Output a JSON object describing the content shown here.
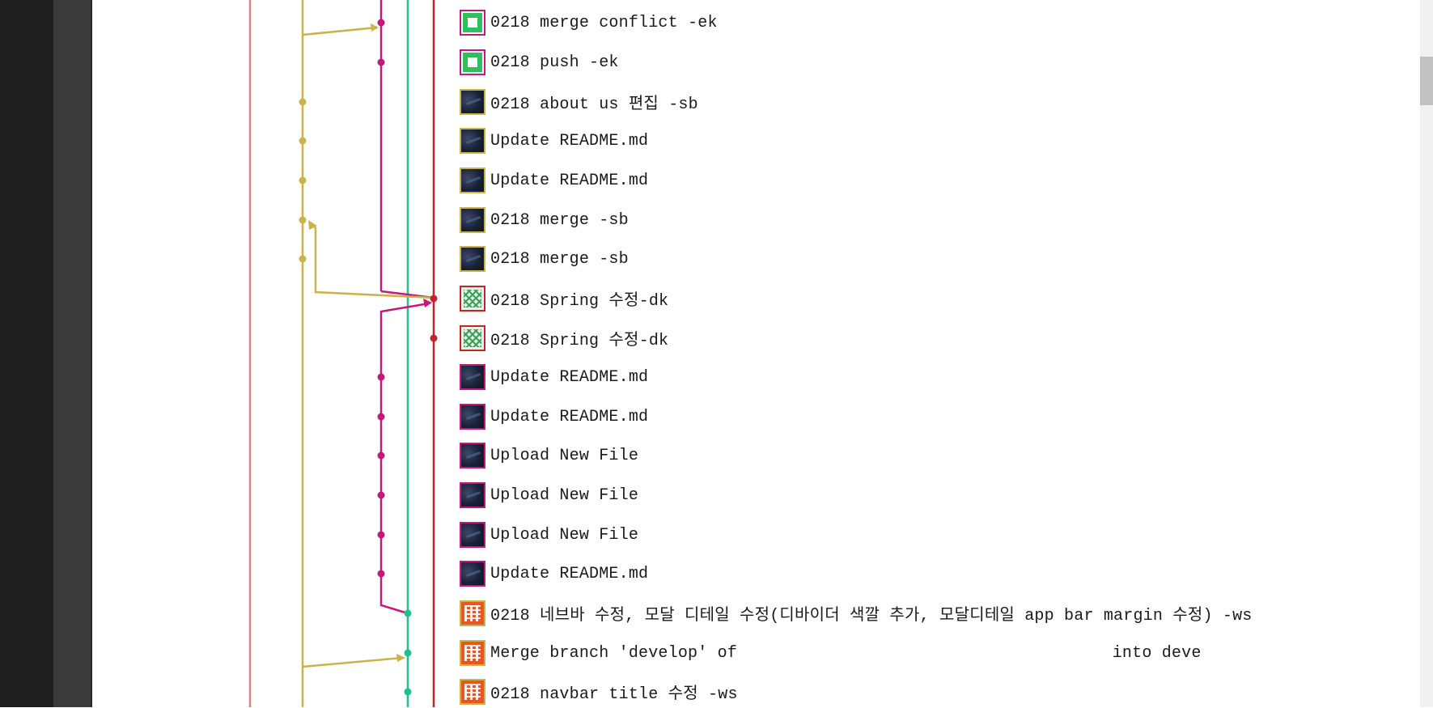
{
  "commits": [
    {
      "message": "0218 merge conflict -ek",
      "avatar": "green-identicon",
      "branch_color": "#c5187a"
    },
    {
      "message": "0218 push -ek",
      "avatar": "green-identicon",
      "branch_color": "#c5187a"
    },
    {
      "message": "0218 about us 편집 -sb",
      "avatar": "night-sky-photo",
      "branch_color": "#c8b44a"
    },
    {
      "message": "Update README.md",
      "avatar": "night-sky-photo",
      "branch_color": "#c8b44a"
    },
    {
      "message": "Update README.md",
      "avatar": "night-sky-photo",
      "branch_color": "#c8b44a"
    },
    {
      "message": "0218 merge -sb",
      "avatar": "night-sky-photo",
      "branch_color": "#c8b44a"
    },
    {
      "message": "0218 merge -sb",
      "avatar": "night-sky-photo",
      "branch_color": "#c8b44a"
    },
    {
      "message": "0218 Spring 수정-dk",
      "avatar": "green-diamond-identicon",
      "branch_color": "#c0272d"
    },
    {
      "message": "0218 Spring 수정-dk",
      "avatar": "green-diamond-identicon",
      "branch_color": "#c0272d"
    },
    {
      "message": "Update README.md",
      "avatar": "night-sky-photo",
      "branch_color": "#c5187a"
    },
    {
      "message": "Update README.md",
      "avatar": "night-sky-photo",
      "branch_color": "#c5187a"
    },
    {
      "message": "Upload New File",
      "avatar": "night-sky-photo",
      "branch_color": "#c5187a"
    },
    {
      "message": "Upload New File",
      "avatar": "night-sky-photo",
      "branch_color": "#c5187a"
    },
    {
      "message": "Upload New File",
      "avatar": "night-sky-photo",
      "branch_color": "#c5187a"
    },
    {
      "message": "Update README.md",
      "avatar": "night-sky-photo",
      "branch_color": "#c5187a"
    },
    {
      "message": "0218 네브바 수정, 모달 디테일 수정(디바이더 색깔 추가, 모달디테일 app bar margin 수정) -ws",
      "avatar": "orange-identicon",
      "branch_color": "#1fbf8f"
    },
    {
      "message": "Merge branch 'develop' of                                      into deve",
      "avatar": "orange-identicon",
      "branch_color": "#1fbf8f"
    },
    {
      "message": "0218 navbar title 수정 -ws",
      "avatar": "orange-identicon",
      "branch_color": "#1fbf8f"
    }
  ],
  "colors": {
    "lane_salmon": "#e08080",
    "lane_olive": "#c8b44a",
    "lane_magenta": "#c5187a",
    "lane_teal": "#1fbf8f",
    "lane_red": "#c0272d"
  }
}
